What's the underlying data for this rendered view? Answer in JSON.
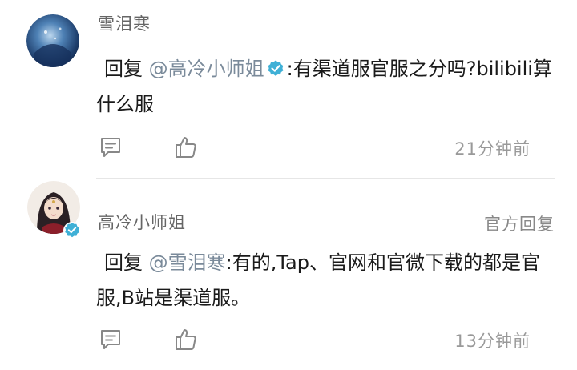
{
  "comments": [
    {
      "username": "雪泪寒",
      "reply_label": "回复",
      "mention": "@高冷小师姐",
      "text": ":有渠道服官服之分吗?bilibili算什么服",
      "time": "21分钟前"
    },
    {
      "username": "高冷小师姐",
      "official_label": "官方回复",
      "reply_label": "回复",
      "mention": "@雪泪寒",
      "text": ":有的,Tap、官网和官微下载的都是官服,B站是渠道服。",
      "time": "13分钟前"
    }
  ],
  "icons": {
    "comment": "comment-icon",
    "like": "thumbs-up-icon",
    "verified": "verified-badge-icon"
  },
  "colors": {
    "verified": "#3fb0d6",
    "mention": "#7a8a9a",
    "meta": "#999999"
  }
}
